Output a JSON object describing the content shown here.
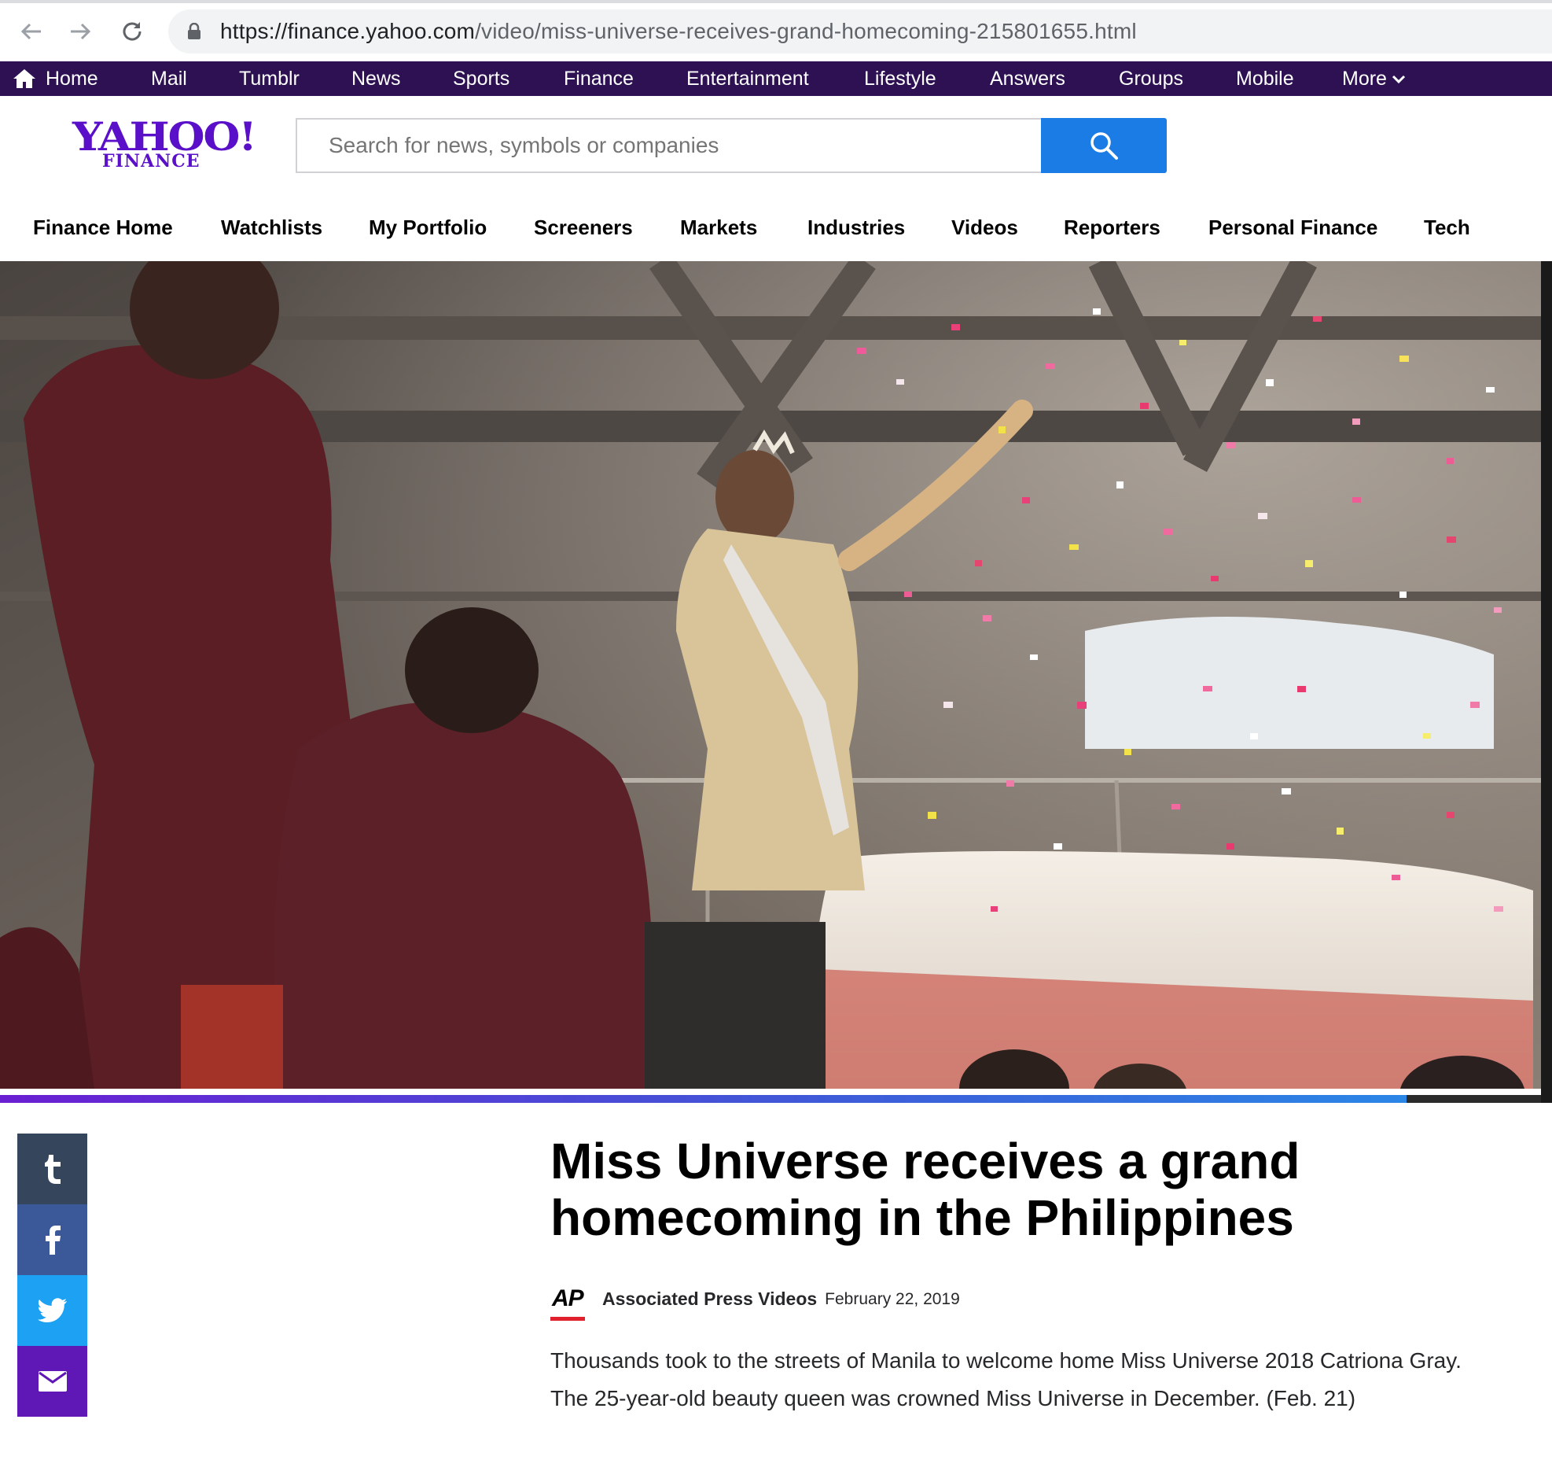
{
  "browser": {
    "url_host": "https://finance.yahoo.com",
    "url_path": "/video/miss-universe-receives-grand-homecoming-215801655.html"
  },
  "yahoo_nav": {
    "items": [
      "Home",
      "Mail",
      "Tumblr",
      "News",
      "Sports",
      "Finance",
      "Entertainment",
      "Lifestyle",
      "Answers",
      "Groups",
      "Mobile",
      "More"
    ]
  },
  "header": {
    "logo_text": "YAHOO!",
    "logo_sub": "FINANCE",
    "search_placeholder": "Search for news, symbols or companies"
  },
  "finance_nav": {
    "items": [
      "Finance Home",
      "Watchlists",
      "My Portfolio",
      "Screeners",
      "Markets",
      "Industries",
      "Videos",
      "Reporters",
      "Personal Finance",
      "Tech"
    ]
  },
  "video": {
    "progress_fraction": 0.913
  },
  "share": [
    "tumblr-icon",
    "facebook-icon",
    "twitter-icon",
    "mail-icon"
  ],
  "article": {
    "headline": "Miss Universe receives a grand homecoming in the Philippines",
    "source_logo": "AP",
    "source": "Associated Press Videos",
    "date": "February 22, 2019",
    "summary": "Thousands took to the streets of Manila to welcome home Miss Universe 2018 Catriona Gray. The 25-year-old beauty queen was crowned Miss Universe in December. (Feb. 21)"
  },
  "colors": {
    "yahoo_purple": "#2d1152",
    "logo_purple": "#5a0fc8",
    "search_blue": "#1b7ce6"
  }
}
